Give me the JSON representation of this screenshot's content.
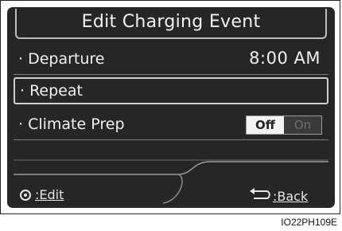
{
  "header": {
    "title": "Edit Charging Event"
  },
  "rows": {
    "departure": {
      "label": "· Departure",
      "value": "8:00 AM"
    },
    "repeat": {
      "label": "· Repeat"
    },
    "climate_prep": {
      "label": "· Climate Prep",
      "toggle_off": "Off",
      "toggle_on": "On",
      "selected": "Off"
    }
  },
  "footer": {
    "edit_label": ":Edit",
    "back_label": ":Back"
  },
  "caption": "IO22PH109E",
  "colors": {
    "screen_bg": "#262626",
    "text": "#f0f0f0",
    "selected_toggle": "#f2f2f2"
  },
  "icons": {
    "edit": "dial-icon",
    "back": "back-arrow-icon"
  }
}
